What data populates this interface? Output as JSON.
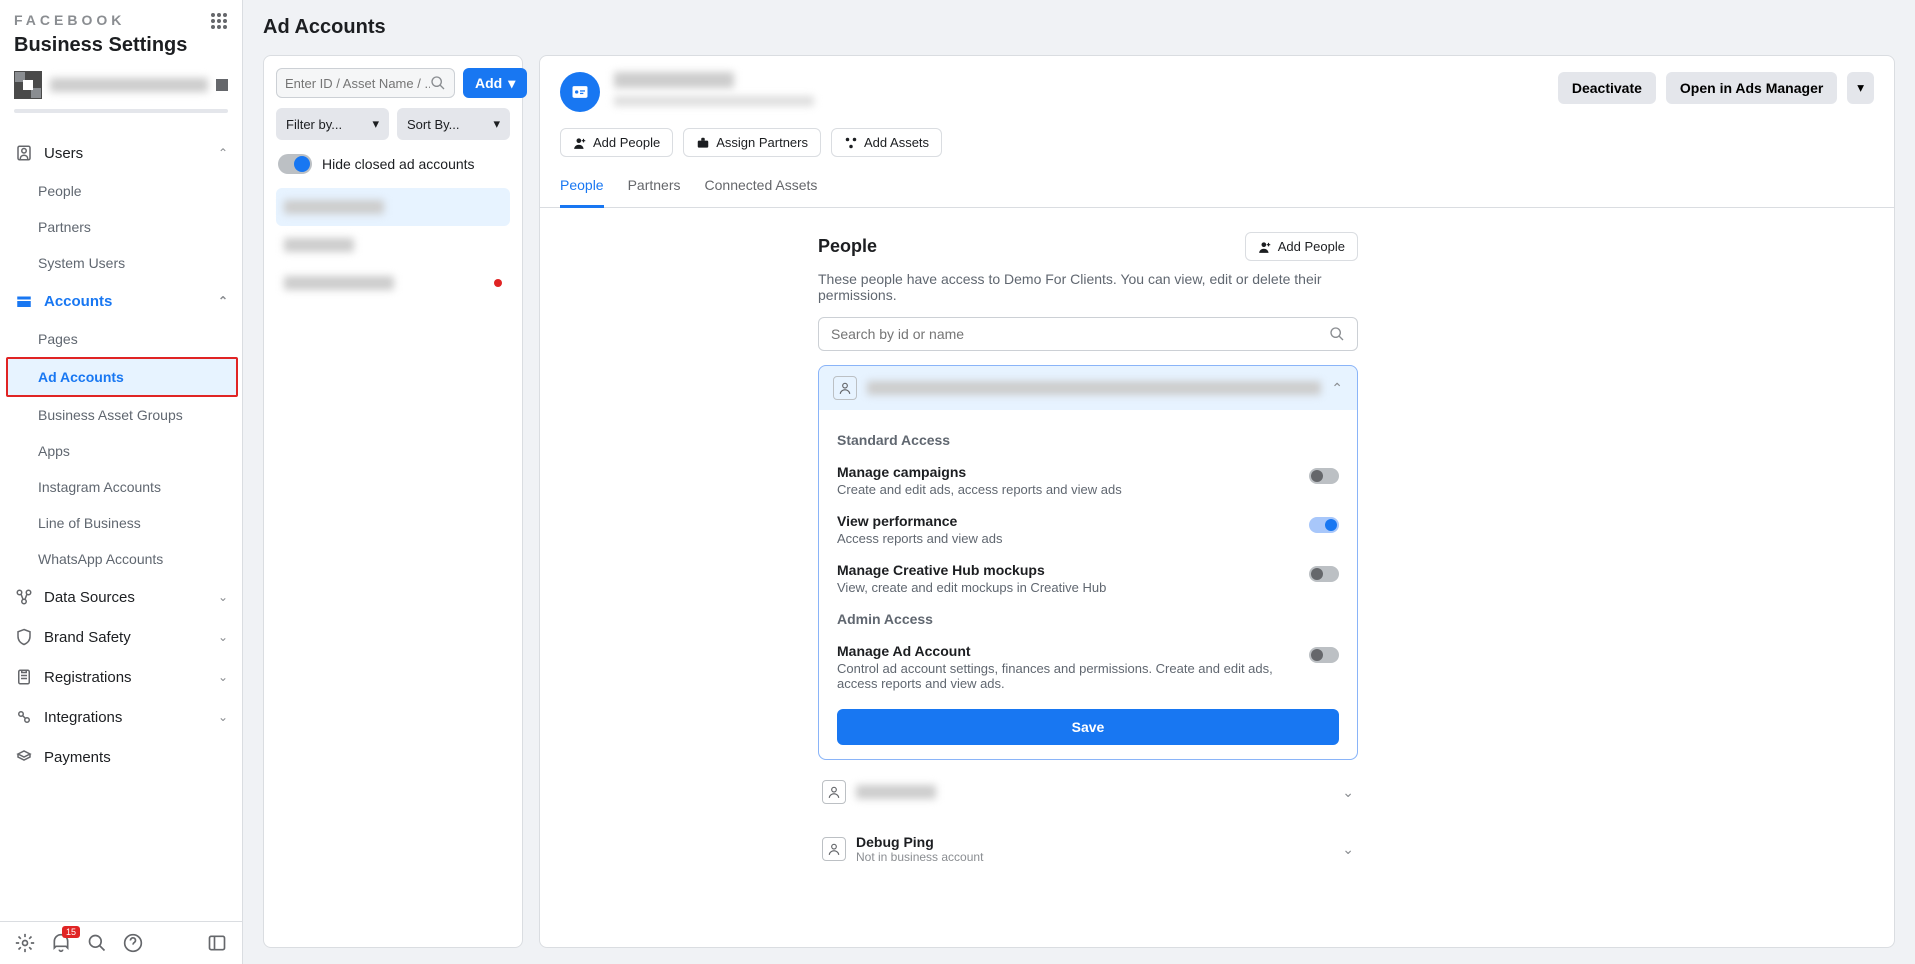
{
  "brand": "FACEBOOK",
  "app_title": "Business Settings",
  "page_title": "Ad Accounts",
  "sidebar": {
    "sections": [
      {
        "label": "Users",
        "expanded": true,
        "active": false,
        "items": [
          {
            "label": "People"
          },
          {
            "label": "Partners"
          },
          {
            "label": "System Users"
          }
        ]
      },
      {
        "label": "Accounts",
        "expanded": true,
        "active": true,
        "items": [
          {
            "label": "Pages"
          },
          {
            "label": "Ad Accounts",
            "highlighted": true
          },
          {
            "label": "Business Asset Groups"
          },
          {
            "label": "Apps"
          },
          {
            "label": "Instagram Accounts"
          },
          {
            "label": "Line of Business"
          },
          {
            "label": "WhatsApp Accounts"
          }
        ]
      },
      {
        "label": "Data Sources",
        "expanded": false,
        "active": false
      },
      {
        "label": "Brand Safety",
        "expanded": false,
        "active": false
      },
      {
        "label": "Registrations",
        "expanded": false,
        "active": false
      },
      {
        "label": "Integrations",
        "expanded": false,
        "active": false
      },
      {
        "label": "Payments",
        "expanded": false,
        "active": false,
        "no_caret": true
      }
    ],
    "footer": {
      "notification_count": "15"
    }
  },
  "asset_list": {
    "search_placeholder": "Enter ID / Asset Name / ...",
    "add_label": "Add",
    "filter_label": "Filter by...",
    "sort_label": "Sort By...",
    "toggle_label": "Hide closed ad accounts"
  },
  "detail": {
    "actions": {
      "deactivate": "Deactivate",
      "open_ads_mgr": "Open in Ads Manager"
    },
    "action_pills": {
      "add_people": "Add People",
      "assign_partners": "Assign Partners",
      "add_assets": "Add Assets"
    },
    "tabs": [
      {
        "label": "People",
        "active": true
      },
      {
        "label": "Partners",
        "active": false
      },
      {
        "label": "Connected Assets",
        "active": false
      }
    ],
    "people": {
      "title": "People",
      "add_label": "Add People",
      "description": "These people have access to Demo For Clients. You can view, edit or delete their permissions.",
      "search_placeholder": "Search by id or name",
      "standard_access_heading": "Standard Access",
      "admin_access_heading": "Admin Access",
      "permissions": [
        {
          "title": "Manage campaigns",
          "desc": "Create and edit ads, access reports and view ads",
          "on": false
        },
        {
          "title": "View performance",
          "desc": "Access reports and view ads",
          "on": true
        },
        {
          "title": "Manage Creative Hub mockups",
          "desc": "View, create and edit mockups in Creative Hub",
          "on": false
        }
      ],
      "admin_permissions": [
        {
          "title": "Manage Ad Account",
          "desc": "Control ad account settings, finances and permissions. Create and edit ads, access reports and view ads.",
          "on": false
        }
      ],
      "save_label": "Save",
      "collapsed_people": [
        {
          "name": "",
          "sub": "",
          "blurred": true
        },
        {
          "name": "Debug Ping",
          "sub": "Not in business account",
          "blurred": false
        }
      ]
    }
  }
}
